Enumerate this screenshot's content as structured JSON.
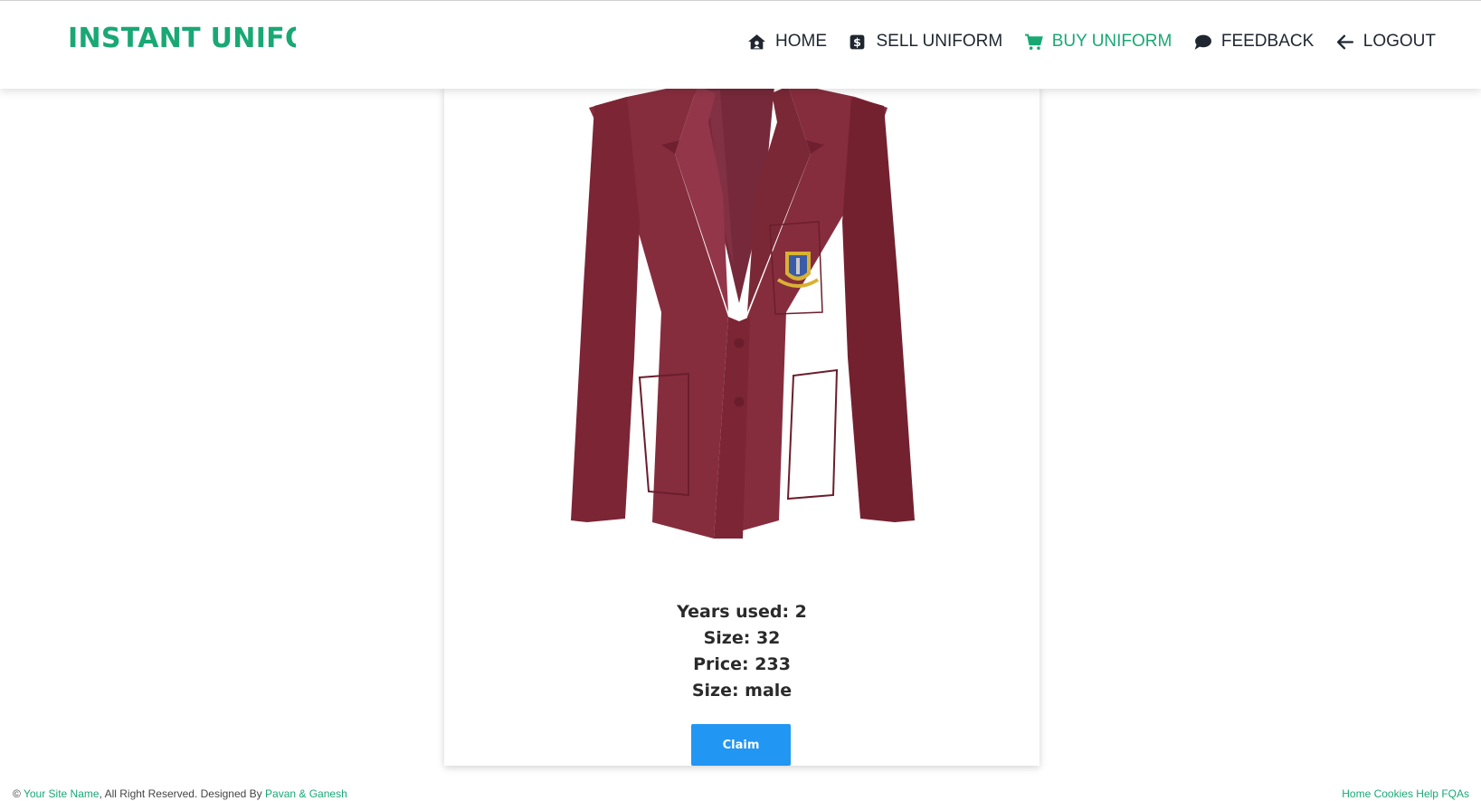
{
  "brand": "INSTANT UNIFORM",
  "nav": {
    "home": {
      "label": "HOME",
      "icon": "home-icon"
    },
    "sell": {
      "label": "SELL UNIFORM",
      "icon": "dollar-icon"
    },
    "buy": {
      "label": "BUY UNIFORM",
      "icon": "cart-icon",
      "active": true
    },
    "feedback": {
      "label": "FEEDBACK",
      "icon": "comment-icon"
    },
    "logout": {
      "label": "LOGOUT",
      "icon": "arrow-left-icon"
    }
  },
  "product": {
    "years_used": "Years used: 2",
    "size": "Size: 32",
    "price": "Price: 233",
    "gender": "Size: male",
    "claim_label": "Claim"
  },
  "footer": {
    "copyright_prefix": "©",
    "site_name": "Your Site Name",
    "rights_text": ", All Right Reserved. Designed By",
    "designer": "Pavan & Ganesh",
    "links": [
      "Home",
      "Cookies",
      "Help",
      "FQAs"
    ]
  },
  "colors": {
    "accent": "#19a874",
    "button": "#2196f3",
    "text": "#1f2630"
  }
}
